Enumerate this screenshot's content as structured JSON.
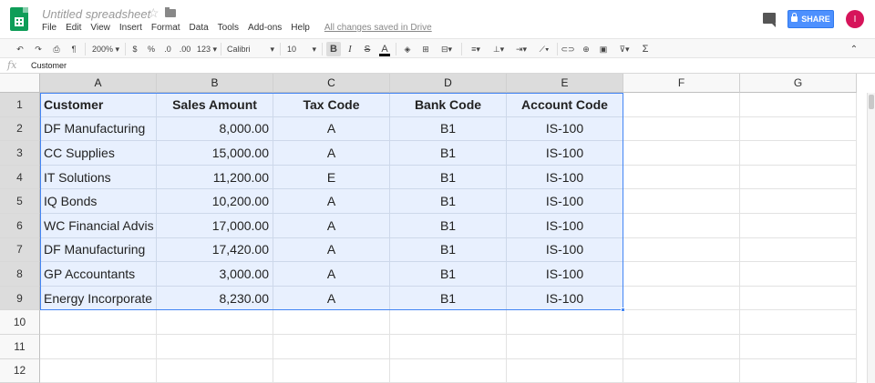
{
  "app": {
    "doc_title": "Untitled spreadsheet",
    "menus": [
      "File",
      "Edit",
      "View",
      "Insert",
      "Format",
      "Data",
      "Tools",
      "Add-ons",
      "Help"
    ],
    "saved_note": "All changes saved in Drive",
    "share_label": "SHARE",
    "avatar_initial": "I"
  },
  "toolbar": {
    "zoom": "200%",
    "currency": "$",
    "percent": "%",
    "decimal_dec": ".0",
    "decimal_inc": ".00",
    "more_formats": "123",
    "font": "Calibri",
    "font_size": "10",
    "bold": "B",
    "italic": "I",
    "text_color": "A",
    "functions": "Σ"
  },
  "formula_bar": {
    "fx": "fx",
    "value": "Customer"
  },
  "grid": {
    "columns": [
      "A",
      "B",
      "C",
      "D",
      "E",
      "F",
      "G"
    ],
    "rows": [
      "1",
      "2",
      "3",
      "4",
      "5",
      "6",
      "7",
      "8",
      "9",
      "10",
      "11",
      "12"
    ],
    "headers": [
      "Customer",
      "Sales Amount",
      "Tax Code",
      "Bank Code",
      "Account Code"
    ],
    "data": [
      [
        "DF Manufacturing",
        "8,000.00",
        "A",
        "B1",
        "IS-100"
      ],
      [
        "CC Supplies",
        "15,000.00",
        "A",
        "B1",
        "IS-100"
      ],
      [
        "IT Solutions",
        "11,200.00",
        "E",
        "B1",
        "IS-100"
      ],
      [
        "IQ Bonds",
        "10,200.00",
        "A",
        "B1",
        "IS-100"
      ],
      [
        "WC Financial Advis",
        "17,000.00",
        "A",
        "B1",
        "IS-100"
      ],
      [
        "DF Manufacturing",
        "17,420.00",
        "A",
        "B1",
        "IS-100"
      ],
      [
        "GP Accountants",
        "3,000.00",
        "A",
        "B1",
        "IS-100"
      ],
      [
        "Energy Incorporate",
        "8,230.00",
        "A",
        "B1",
        "IS-100"
      ]
    ]
  },
  "colors": {
    "selection_fill": "#e8f0fe",
    "selection_border": "#4285f4",
    "share_blue": "#4d90fe",
    "avatar_pink": "#d6145a",
    "sheets_green": "#0f9d58"
  }
}
